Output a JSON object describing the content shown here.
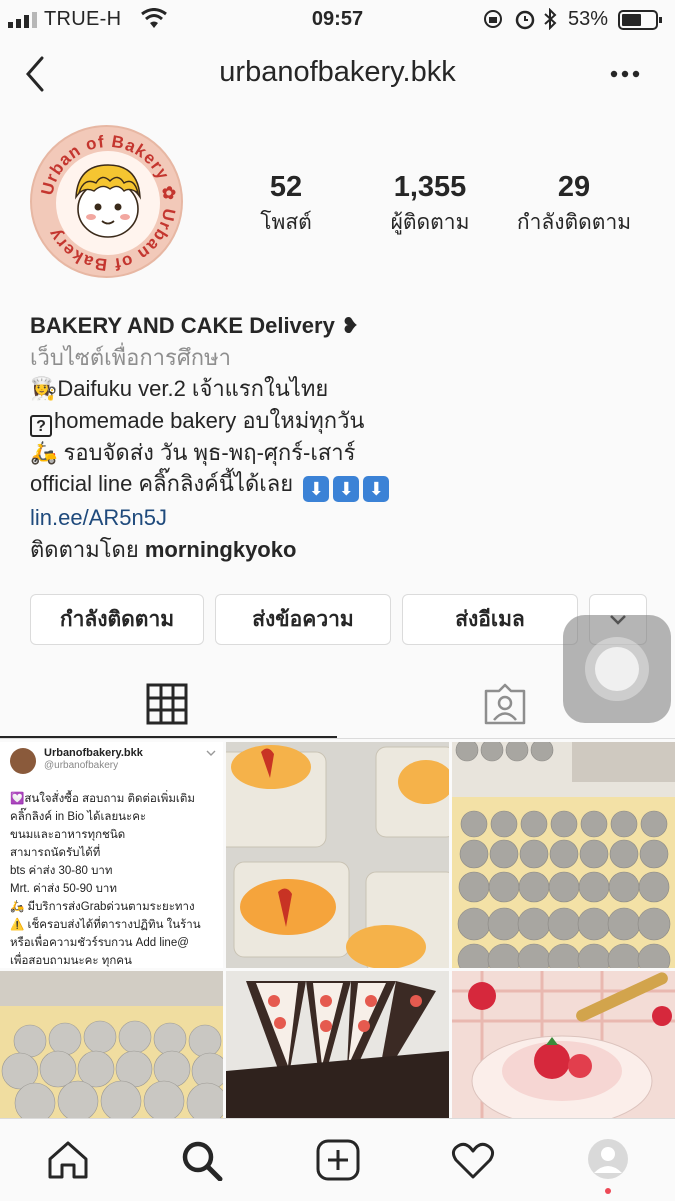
{
  "status_bar": {
    "carrier": "TRUE-H",
    "time": "09:57",
    "battery": "53%"
  },
  "header": {
    "username": "urbanofbakery.bkk"
  },
  "profile": {
    "avatar_text": "Urban of Bakery",
    "stats": [
      {
        "value": "52",
        "label": "โพสต์"
      },
      {
        "value": "1,355",
        "label": "ผู้ติดตาม"
      },
      {
        "value": "29",
        "label": "กำลังติดตาม"
      }
    ]
  },
  "bio": {
    "name": "BAKERY AND CAKE Delivery ❥",
    "category": "เว็บไซต์เพื่อการศึกษา",
    "line1": "Daifuku ver.2 เจ้าแรกในไทย",
    "line2_mark": "?",
    "line2": "homemade bakery อบใหม่ทุกวัน",
    "line3": "รอบจัดส่ง วัน พุธ-พฤ-ศุกร์-เสาร์",
    "line4": "official line คลิ๊กลิงค์นี้ได้เลย",
    "arrow": "⬇",
    "link": "lin.ee/AR5n5J",
    "followed_prefix": "ติดตามโดย",
    "followed_user": "morningkyoko"
  },
  "buttons": {
    "following": "กำลังติดตาม",
    "message": "ส่งข้อความ",
    "email": "ส่งอีเมล",
    "more": "⌄"
  },
  "post_card": {
    "name": "Urbanofbakery.bkk",
    "handle": "@urbanofbakery",
    "lines": [
      "💟สนใจสั่งซื้อ สอบถาม ติดต่อเพิ่มเติม",
      "คลิ๊กลิงค์ in Bio ได้เลยนะคะ",
      "ขนมและอาหารทุกชนิด",
      "สามารถนัดรับได้ที่",
      "bts ค่าส่ง 30-80 บาท",
      "Mrt. ค่าส่ง 50-90 บาท",
      "🛵 มีบริการส่งGrabด่วนตามระยะทาง",
      "⚠️ เช็ครอบส่งได้ที่ตารางปฏิทิน ในร้าน",
      "หรือเพื่อความชัวร์รบกวน Add line@",
      "เพื่อสอบถามนะคะ ทุกคน"
    ]
  }
}
